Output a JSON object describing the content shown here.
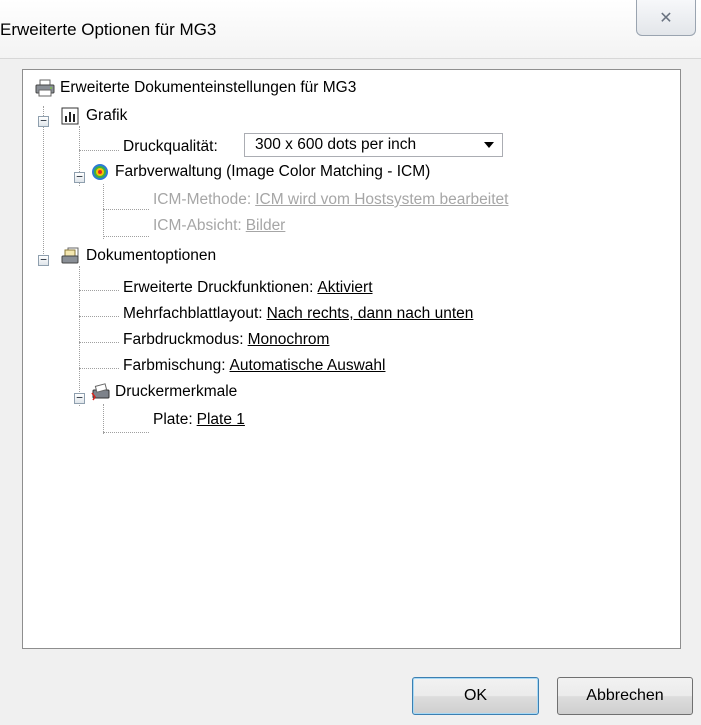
{
  "window": {
    "title": "Erweiterte Optionen für MG3",
    "close_glyph": "✕"
  },
  "tree": {
    "root_label": "Erweiterte Dokumenteinstellungen für MG3",
    "grafik": {
      "label": "Grafik",
      "druckqualitaet": {
        "label": "Druckqualität:",
        "value": "300 x 600 dots per inch"
      },
      "farbverwaltung": {
        "label": "Farbverwaltung (Image Color Matching - ICM)",
        "icm_methode": {
          "label": "ICM-Methode:",
          "value": "ICM wird vom Hostsystem bearbeitet"
        },
        "icm_absicht": {
          "label": "ICM-Absicht:",
          "value": "Bilder"
        }
      }
    },
    "dokumentoptionen": {
      "label": "Dokumentoptionen",
      "items": [
        {
          "label": "Erweiterte Druckfunktionen:",
          "value": "Aktiviert"
        },
        {
          "label": "Mehrfachblattlayout:",
          "value": "Nach rechts, dann nach unten"
        },
        {
          "label": "Farbdruckmodus:",
          "value": "Monochrom"
        },
        {
          "label": "Farbmischung:",
          "value": "Automatische Auswahl"
        }
      ],
      "druckermerkmale": {
        "label": "Druckermerkmale",
        "plate": {
          "label": "Plate:",
          "value": "Plate 1"
        }
      }
    },
    "expander_glyph": "−"
  },
  "buttons": {
    "ok": "OK",
    "cancel": "Abbrechen"
  },
  "icons": [
    "printer-icon",
    "chart-icon",
    "color-wheel-icon",
    "documents-icon",
    "printer-features-icon"
  ]
}
